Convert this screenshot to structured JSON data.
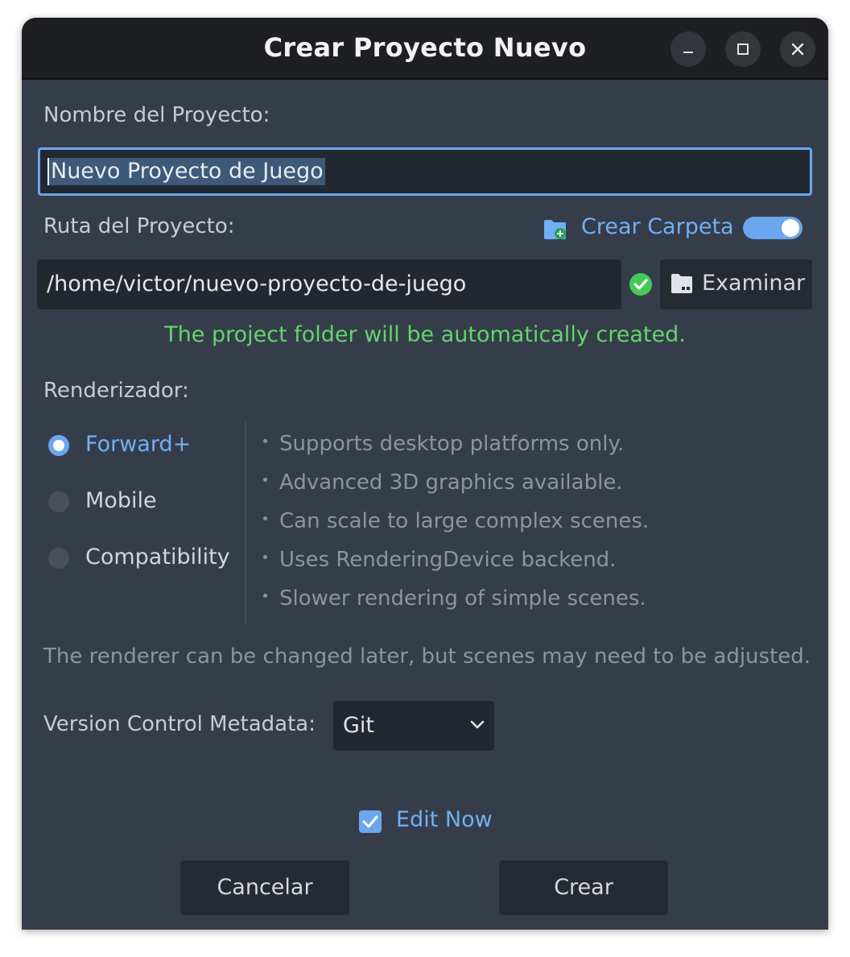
{
  "window": {
    "title": "Crear Proyecto Nuevo",
    "controls": [
      "minimize-icon",
      "maximize-icon",
      "close-icon"
    ]
  },
  "project_name": {
    "label": "Nombre del Proyecto:",
    "value": "Nuevo Proyecto de Juego"
  },
  "project_path": {
    "label": "Ruta del Proyecto:",
    "create_folder_label": "Crear Carpeta",
    "create_folder_enabled": true,
    "value": "/home/victor/nuevo-proyecto-de-juego",
    "browse_label": "Examinar",
    "status_message": "The project folder will be automatically created."
  },
  "renderer": {
    "label": "Renderizador:",
    "options": [
      {
        "label": "Forward+",
        "selected": true
      },
      {
        "label": "Mobile",
        "selected": false
      },
      {
        "label": "Compatibility",
        "selected": false
      }
    ],
    "features": [
      "Supports desktop platforms only.",
      "Advanced 3D graphics available.",
      "Can scale to large complex scenes.",
      "Uses RenderingDevice backend.",
      "Slower rendering of simple scenes."
    ],
    "note": "The renderer can be changed later, but scenes may need to be adjusted."
  },
  "vcs": {
    "label": "Version Control Metadata:",
    "selected": "Git"
  },
  "edit_now": {
    "label": "Edit Now",
    "checked": true
  },
  "actions": {
    "cancel_label": "Cancelar",
    "create_label": "Crear"
  },
  "colors": {
    "accent": "#6aa7ef",
    "success": "#62d66a",
    "background": "#363d4a",
    "titlebar": "#1d1f23"
  }
}
